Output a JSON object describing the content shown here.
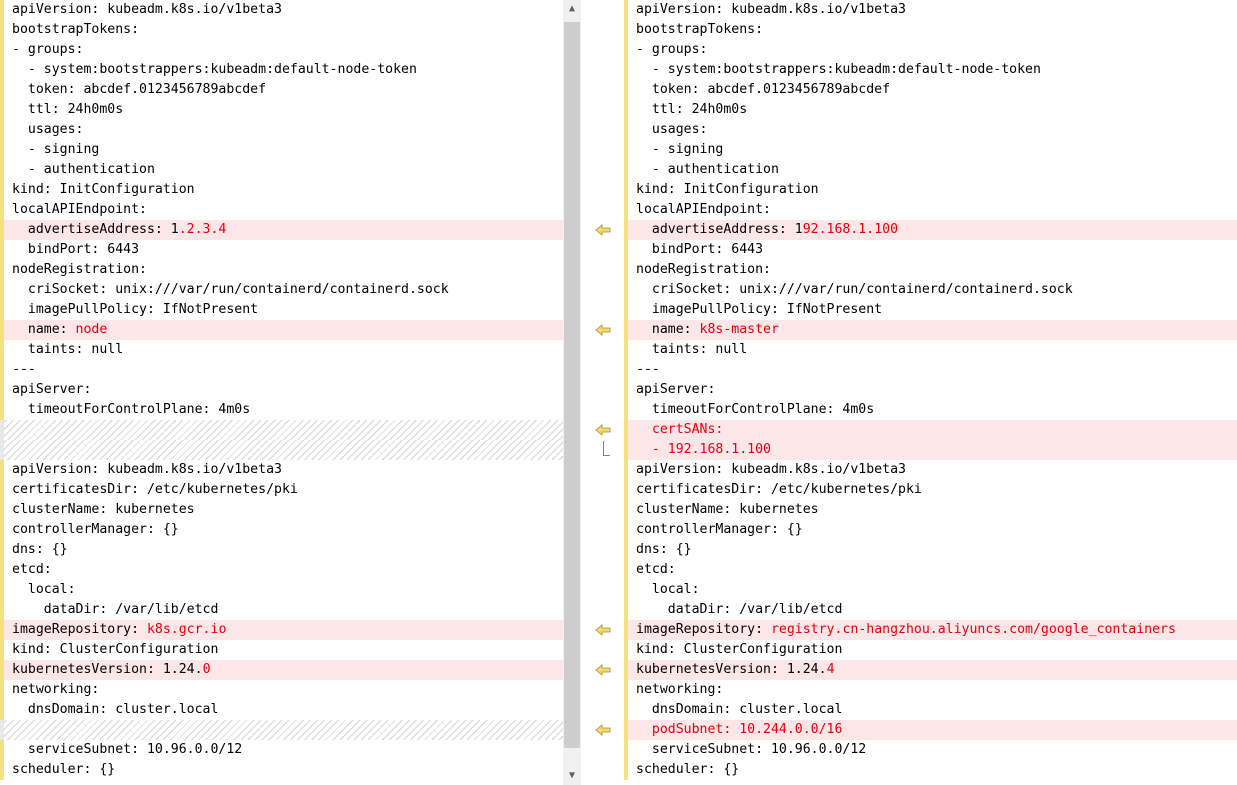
{
  "left_pane": {
    "lines": [
      {
        "kind": "normal",
        "segments": [
          {
            "text": "apiVersion: kubeadm.k8s.io/v1beta3"
          }
        ]
      },
      {
        "kind": "normal",
        "segments": [
          {
            "text": "bootstrapTokens:"
          }
        ]
      },
      {
        "kind": "normal",
        "segments": [
          {
            "text": "- groups:"
          }
        ]
      },
      {
        "kind": "normal",
        "segments": [
          {
            "text": "  - system:bootstrappers:kubeadm:default-node-token"
          }
        ]
      },
      {
        "kind": "normal",
        "segments": [
          {
            "text": "  token: abcdef.0123456789abcdef"
          }
        ]
      },
      {
        "kind": "normal",
        "segments": [
          {
            "text": "  ttl: 24h0m0s"
          }
        ]
      },
      {
        "kind": "normal",
        "segments": [
          {
            "text": "  usages:"
          }
        ]
      },
      {
        "kind": "normal",
        "segments": [
          {
            "text": "  - signing"
          }
        ]
      },
      {
        "kind": "normal",
        "segments": [
          {
            "text": "  - authentication"
          }
        ]
      },
      {
        "kind": "normal",
        "segments": [
          {
            "text": "kind: InitConfiguration"
          }
        ]
      },
      {
        "kind": "normal",
        "segments": [
          {
            "text": "localAPIEndpoint:"
          }
        ]
      },
      {
        "kind": "diff",
        "segments": [
          {
            "text": "  advertiseAddress: 1"
          },
          {
            "text": ".2.3.4",
            "chg": true
          }
        ]
      },
      {
        "kind": "normal",
        "segments": [
          {
            "text": "  bindPort: 6443"
          }
        ]
      },
      {
        "kind": "normal",
        "segments": [
          {
            "text": "nodeRegistration:"
          }
        ]
      },
      {
        "kind": "normal",
        "segments": [
          {
            "text": "  criSocket: unix:///var/run/containerd/containerd.sock"
          }
        ]
      },
      {
        "kind": "normal",
        "segments": [
          {
            "text": "  imagePullPolicy: IfNotPresent"
          }
        ]
      },
      {
        "kind": "diff",
        "segments": [
          {
            "text": "  name: "
          },
          {
            "text": "node",
            "chg": true
          }
        ]
      },
      {
        "kind": "normal",
        "segments": [
          {
            "text": "  taints: null"
          }
        ]
      },
      {
        "kind": "normal",
        "segments": [
          {
            "text": "---"
          }
        ]
      },
      {
        "kind": "normal",
        "segments": [
          {
            "text": "apiServer:"
          }
        ]
      },
      {
        "kind": "normal",
        "segments": [
          {
            "text": "  timeoutForControlPlane: 4m0s"
          }
        ]
      },
      {
        "kind": "hatch",
        "segments": []
      },
      {
        "kind": "hatch",
        "segments": []
      },
      {
        "kind": "normal",
        "segments": [
          {
            "text": "apiVersion: kubeadm.k8s.io/v1beta3"
          }
        ]
      },
      {
        "kind": "normal",
        "segments": [
          {
            "text": "certificatesDir: /etc/kubernetes/pki"
          }
        ]
      },
      {
        "kind": "normal",
        "segments": [
          {
            "text": "clusterName: kubernetes"
          }
        ]
      },
      {
        "kind": "normal",
        "segments": [
          {
            "text": "controllerManager: {}"
          }
        ]
      },
      {
        "kind": "normal",
        "segments": [
          {
            "text": "dns: {}"
          }
        ]
      },
      {
        "kind": "normal",
        "segments": [
          {
            "text": "etcd:"
          }
        ]
      },
      {
        "kind": "normal",
        "segments": [
          {
            "text": "  local:"
          }
        ]
      },
      {
        "kind": "normal",
        "segments": [
          {
            "text": "    dataDir: /var/lib/etcd"
          }
        ]
      },
      {
        "kind": "diff",
        "segments": [
          {
            "text": "imageRepository: "
          },
          {
            "text": "k8s.gcr.io",
            "chg": true
          }
        ]
      },
      {
        "kind": "normal",
        "segments": [
          {
            "text": "kind: ClusterConfiguration"
          }
        ]
      },
      {
        "kind": "diff",
        "segments": [
          {
            "text": "kubernetesVersion: 1.24."
          },
          {
            "text": "0",
            "chg": true
          }
        ]
      },
      {
        "kind": "normal",
        "segments": [
          {
            "text": "networking:"
          }
        ]
      },
      {
        "kind": "normal",
        "segments": [
          {
            "text": "  dnsDomain: cluster.local"
          }
        ]
      },
      {
        "kind": "hatch",
        "segments": []
      },
      {
        "kind": "normal",
        "segments": [
          {
            "text": "  serviceSubnet: 10.96.0.0/12"
          }
        ]
      },
      {
        "kind": "normal",
        "segments": [
          {
            "text": "scheduler: {}"
          }
        ]
      }
    ]
  },
  "right_pane": {
    "lines": [
      {
        "kind": "normal",
        "segments": [
          {
            "text": "apiVersion: kubeadm.k8s.io/v1beta3"
          }
        ]
      },
      {
        "kind": "normal",
        "segments": [
          {
            "text": "bootstrapTokens:"
          }
        ]
      },
      {
        "kind": "normal",
        "segments": [
          {
            "text": "- groups:"
          }
        ]
      },
      {
        "kind": "normal",
        "segments": [
          {
            "text": "  - system:bootstrappers:kubeadm:default-node-token"
          }
        ]
      },
      {
        "kind": "normal",
        "segments": [
          {
            "text": "  token: abcdef.0123456789abcdef"
          }
        ]
      },
      {
        "kind": "normal",
        "segments": [
          {
            "text": "  ttl: 24h0m0s"
          }
        ]
      },
      {
        "kind": "normal",
        "segments": [
          {
            "text": "  usages:"
          }
        ]
      },
      {
        "kind": "normal",
        "segments": [
          {
            "text": "  - signing"
          }
        ]
      },
      {
        "kind": "normal",
        "segments": [
          {
            "text": "  - authentication"
          }
        ]
      },
      {
        "kind": "normal",
        "segments": [
          {
            "text": "kind: InitConfiguration"
          }
        ]
      },
      {
        "kind": "normal",
        "segments": [
          {
            "text": "localAPIEndpoint:"
          }
        ]
      },
      {
        "kind": "diff",
        "segments": [
          {
            "text": "  advertiseAddress: 1"
          },
          {
            "text": "92.168.1.100",
            "chg": true
          }
        ]
      },
      {
        "kind": "normal",
        "segments": [
          {
            "text": "  bindPort: 6443"
          }
        ]
      },
      {
        "kind": "normal",
        "segments": [
          {
            "text": "nodeRegistration:"
          }
        ]
      },
      {
        "kind": "normal",
        "segments": [
          {
            "text": "  criSocket: unix:///var/run/containerd/containerd.sock"
          }
        ]
      },
      {
        "kind": "normal",
        "segments": [
          {
            "text": "  imagePullPolicy: IfNotPresent"
          }
        ]
      },
      {
        "kind": "diff",
        "segments": [
          {
            "text": "  name: "
          },
          {
            "text": "k8s-master",
            "chg": true
          }
        ]
      },
      {
        "kind": "normal",
        "segments": [
          {
            "text": "  taints: null"
          }
        ]
      },
      {
        "kind": "normal",
        "segments": [
          {
            "text": "---"
          }
        ]
      },
      {
        "kind": "normal",
        "segments": [
          {
            "text": "apiServer:"
          }
        ]
      },
      {
        "kind": "normal",
        "segments": [
          {
            "text": "  timeoutForControlPlane: 4m0s"
          }
        ]
      },
      {
        "kind": "diff",
        "segments": [
          {
            "text": "  certSANs:",
            "chg": true
          }
        ]
      },
      {
        "kind": "diff",
        "segments": [
          {
            "text": "  - 192.168.1.100",
            "chg": true
          }
        ]
      },
      {
        "kind": "normal",
        "segments": [
          {
            "text": "apiVersion: kubeadm.k8s.io/v1beta3"
          }
        ]
      },
      {
        "kind": "normal",
        "segments": [
          {
            "text": "certificatesDir: /etc/kubernetes/pki"
          }
        ]
      },
      {
        "kind": "normal",
        "segments": [
          {
            "text": "clusterName: kubernetes"
          }
        ]
      },
      {
        "kind": "normal",
        "segments": [
          {
            "text": "controllerManager: {}"
          }
        ]
      },
      {
        "kind": "normal",
        "segments": [
          {
            "text": "dns: {}"
          }
        ]
      },
      {
        "kind": "normal",
        "segments": [
          {
            "text": "etcd:"
          }
        ]
      },
      {
        "kind": "normal",
        "segments": [
          {
            "text": "  local:"
          }
        ]
      },
      {
        "kind": "normal",
        "segments": [
          {
            "text": "    dataDir: /var/lib/etcd"
          }
        ]
      },
      {
        "kind": "diff",
        "segments": [
          {
            "text": "imageRepository: "
          },
          {
            "text": "registry.cn-hangzhou.aliyuncs.com/google_containers",
            "chg": true
          }
        ]
      },
      {
        "kind": "normal",
        "segments": [
          {
            "text": "kind: ClusterConfiguration"
          }
        ]
      },
      {
        "kind": "diff",
        "segments": [
          {
            "text": "kubernetesVersion: 1.24."
          },
          {
            "text": "4",
            "chg": true
          }
        ]
      },
      {
        "kind": "normal",
        "segments": [
          {
            "text": "networking:"
          }
        ]
      },
      {
        "kind": "normal",
        "segments": [
          {
            "text": "  dnsDomain: cluster.local"
          }
        ]
      },
      {
        "kind": "diff",
        "segments": [
          {
            "text": "  podSubnet: 10.244.0.0/16",
            "chg": true
          }
        ]
      },
      {
        "kind": "normal",
        "segments": [
          {
            "text": "  serviceSubnet: 10.96.0.0/12"
          }
        ]
      },
      {
        "kind": "normal",
        "segments": [
          {
            "text": "scheduler: {}"
          }
        ]
      }
    ]
  },
  "gutter": {
    "copy_arrow_line_indices": [
      11,
      16,
      21,
      31,
      33,
      36
    ],
    "arrow_icon": "copy-left-arrow-icon",
    "arrow_color": "#f5d77a",
    "bracket_line_index": 22
  },
  "scrollbar": {
    "up_icon": "scroll-up-arrow-icon",
    "down_icon": "scroll-down-arrow-icon",
    "up_glyph": "▲",
    "down_glyph": "▼"
  },
  "colors": {
    "diff_background": "#fde6e7",
    "changed_text": "#e8000b",
    "margin_bar": "#f3e27e"
  }
}
